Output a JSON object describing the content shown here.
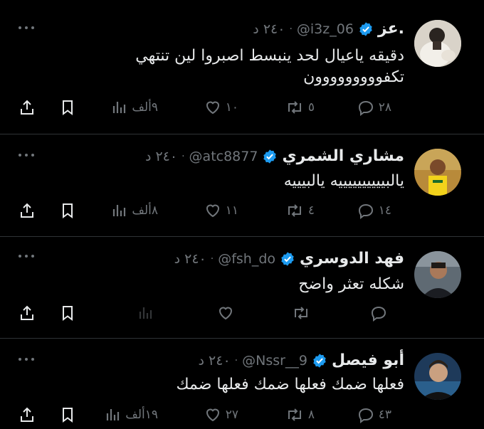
{
  "tweets": [
    {
      "name": "عز.",
      "handle": "@i3z_06",
      "time": "٢٤٠ د",
      "text_lines": [
        "دقيقه ياعيال لحد ينبسط اصبروا لين تنتهي",
        "تكفووووووووون"
      ],
      "replies": "٢٨",
      "retweets": "٥",
      "likes": "١٠",
      "views": "٩ألف"
    },
    {
      "name": "مشاري الشمري",
      "handle": "@atc8877",
      "time": "٢٤٠ د",
      "text_lines": [
        "يالبييييييييييه يالبيييه"
      ],
      "replies": "١٤",
      "retweets": "٤",
      "likes": "١١",
      "views": "٨ألف"
    },
    {
      "name": "فهد الدوسري",
      "handle": "@fsh_do",
      "time": "٢٤٠ د",
      "text_lines": [
        "شكله تعثر واضح"
      ],
      "replies": "",
      "retweets": "",
      "likes": "",
      "views": ""
    },
    {
      "name": "أبو فيصل",
      "handle": "@Nssr__9",
      "time": "٢٤٠ د",
      "text_lines": [
        "فعلها ضمك فعلها ضمك فعلها ضمك"
      ],
      "replies": "٤٣",
      "retweets": "٨",
      "likes": "٢٧",
      "views": "١٩ألف"
    }
  ],
  "colors": {
    "background": "#000000",
    "text": "#e7e9ea",
    "muted": "#71767b",
    "verified": "#1d9bf0",
    "divider": "#2f3336"
  },
  "icons": [
    "reply-icon",
    "retweet-icon",
    "like-icon",
    "views-icon",
    "bookmark-icon",
    "share-icon",
    "more-icon",
    "verified-icon"
  ]
}
